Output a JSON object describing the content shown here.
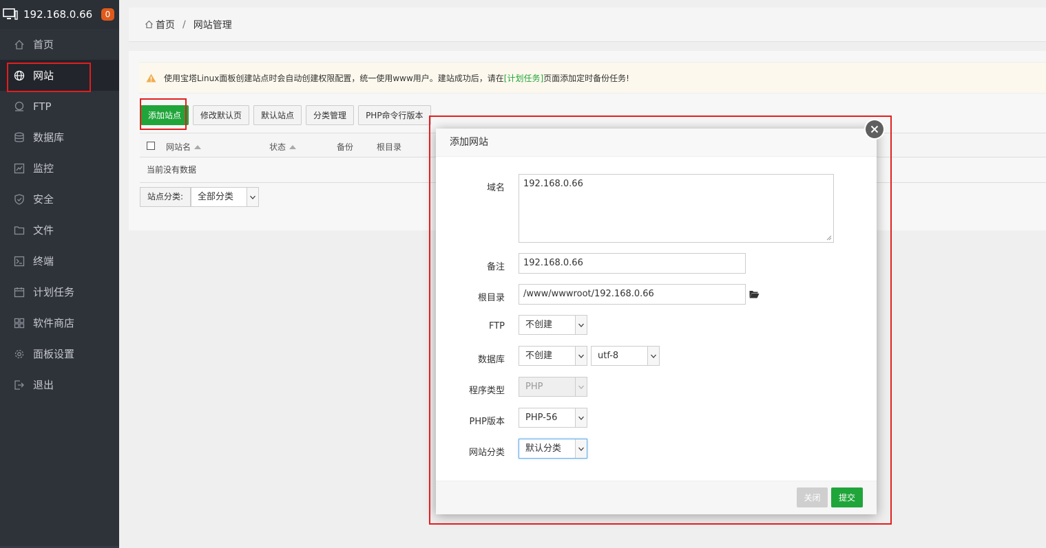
{
  "sidebar": {
    "server_ip": "192.168.0.66",
    "notification_count": "0",
    "items": [
      {
        "label": "首页",
        "icon": "home-icon"
      },
      {
        "label": "网站",
        "icon": "globe-icon",
        "active": true
      },
      {
        "label": "FTP",
        "icon": "ftp-icon"
      },
      {
        "label": "数据库",
        "icon": "database-icon"
      },
      {
        "label": "监控",
        "icon": "monitor-icon"
      },
      {
        "label": "安全",
        "icon": "shield-icon"
      },
      {
        "label": "文件",
        "icon": "folder-icon"
      },
      {
        "label": "终端",
        "icon": "terminal-icon"
      },
      {
        "label": "计划任务",
        "icon": "calendar-icon"
      },
      {
        "label": "软件商店",
        "icon": "apps-icon"
      },
      {
        "label": "面板设置",
        "icon": "gear-icon"
      },
      {
        "label": "退出",
        "icon": "logout-icon"
      }
    ]
  },
  "breadcrumb": {
    "home": "首页",
    "separator": "/",
    "current": "网站管理"
  },
  "notice": {
    "text_before": "使用宝塔Linux面板创建站点时会自动创建权限配置，统一使用www用户。建站成功后，请在",
    "link": "[计划任务]",
    "text_after": "页面添加定时备份任务!"
  },
  "toolbar": {
    "add_site": "添加站点",
    "edit_default_page": "修改默认页",
    "default_site": "默认站点",
    "category_manage": "分类管理",
    "php_cli_version": "PHP命令行版本"
  },
  "table": {
    "columns": [
      "网站名",
      "状态",
      "备份",
      "根目录"
    ],
    "empty_text": "当前没有数据"
  },
  "site_category_filter": {
    "label": "站点分类:",
    "value": "全部分类"
  },
  "modal": {
    "title": "添加网站",
    "fields": {
      "domain": {
        "label": "域名",
        "value": "192.168.0.66"
      },
      "remark": {
        "label": "备注",
        "value": "192.168.0.66"
      },
      "root_dir": {
        "label": "根目录",
        "value": "/www/wwwroot/192.168.0.66"
      },
      "ftp": {
        "label": "FTP",
        "value": "不创建"
      },
      "database": {
        "label": "数据库",
        "value": "不创建",
        "charset": "utf-8"
      },
      "program_type": {
        "label": "程序类型",
        "value": "PHP"
      },
      "php_version": {
        "label": "PHP版本",
        "value": "PHP-56"
      },
      "site_category": {
        "label": "网站分类",
        "value": "默认分类"
      }
    },
    "buttons": {
      "close": "关闭",
      "submit": "提交"
    }
  },
  "colors": {
    "accent_green": "#20a53a",
    "sidebar_bg": "#353a44",
    "highlight_red": "#e31e1e",
    "badge_orange": "#e05a1b"
  }
}
